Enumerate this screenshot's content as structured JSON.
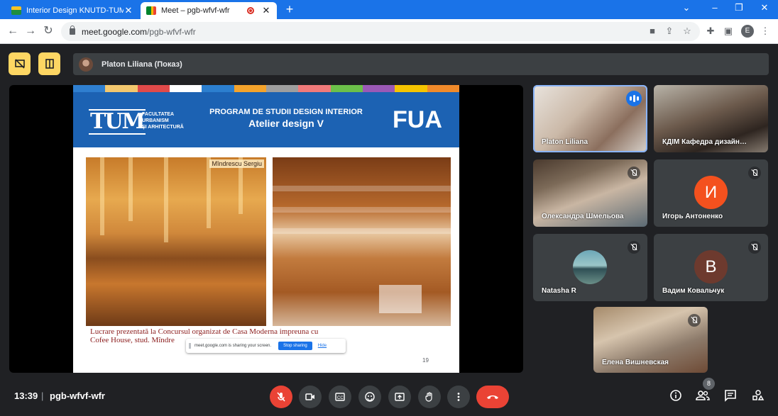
{
  "browser": {
    "tabs": [
      {
        "title": "Interior Design KNUTD-TUM • …",
        "active": false
      },
      {
        "title": "Meet – pgb-wfvf-wfr",
        "active": true
      }
    ],
    "url_host": "meet.google.com",
    "url_path": "/pgb-wfvf-wfr",
    "profile_initial": "E"
  },
  "presenter": {
    "name": "Platon Liliana (Показ)"
  },
  "slide": {
    "logo_text": "TUM",
    "faculty": "FACULTATEA\nURBANISM\nŞI ARHITECTURĂ",
    "program_title": "PROGRAM DE  STUDII DESIGN INTERIOR",
    "program_subtitle": "Atelier design V",
    "fua": "FUA",
    "photo_caption": "Mîndrescu Sergiu",
    "text_line1": "Lucrare prezentată la Concursul organizat de Casa Moderna impreuna cu",
    "text_line2": "Cofee House, stud. Mîndre",
    "page_number": "19",
    "strip_colors": [
      "#2f7fd0",
      "#f2c76e",
      "#e04a4a",
      "#ffffff",
      "#2c7fcf",
      "#f4a32b",
      "#9e9e9e",
      "#f07a7a",
      "#6cc04a",
      "#9b59b6",
      "#f5c400",
      "#f08a2a"
    ]
  },
  "share_notice": {
    "text": "meet.google.com is sharing your screen.",
    "stop": "Stop sharing",
    "hide": "Hide"
  },
  "participants": [
    {
      "name": "Platon Liliana",
      "type": "video",
      "speaking": true
    },
    {
      "name": "КДІМ Кафедра дизайн…",
      "type": "video",
      "speaking": false
    },
    {
      "name": "Олександра Шмельова",
      "type": "video",
      "muted": true
    },
    {
      "name": "Игорь Антоненко",
      "type": "letter",
      "letter": "И",
      "color": "#f4511e",
      "muted": true
    },
    {
      "name": "Natasha R",
      "type": "photo",
      "muted": true
    },
    {
      "name": "Вадим Ковальчук",
      "type": "letter",
      "letter": "В",
      "color": "#6d3a2e",
      "muted": true
    },
    {
      "name": "Елена Вишневская",
      "type": "video",
      "muted": true
    }
  ],
  "footer": {
    "time": "13:39",
    "separator": "|",
    "meeting_code": "pgb-wfvf-wfr",
    "participant_count": "8"
  },
  "colors": {
    "tab_bar": "#1a73e8",
    "accent_yellow": "#fdd663",
    "hangup_red": "#ea4335",
    "meet_bg": "#202124"
  }
}
